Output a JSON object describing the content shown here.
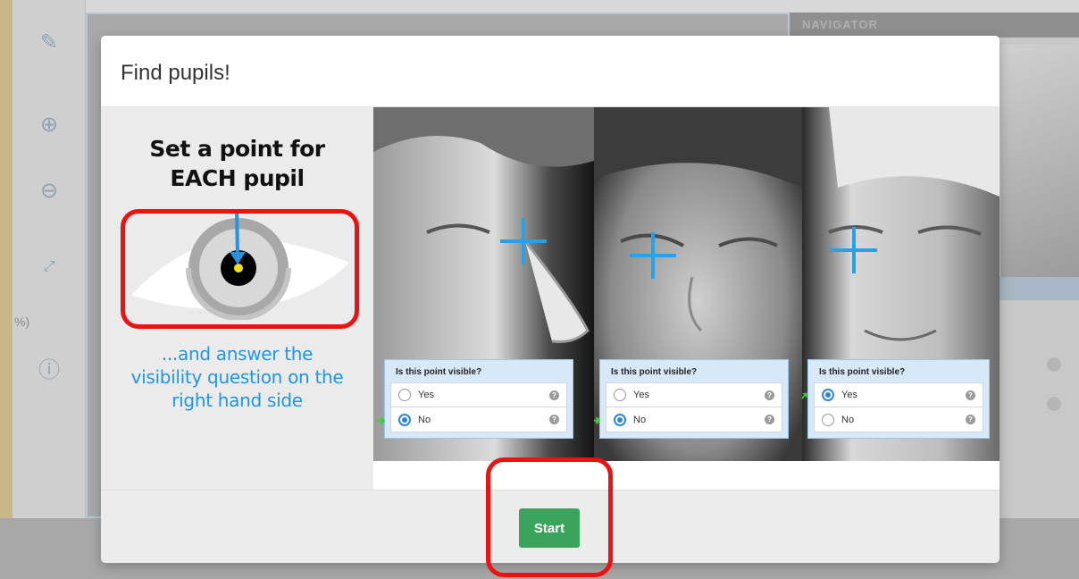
{
  "background": {
    "navigator_title": "NAVIGATOR",
    "percent_label": "%)"
  },
  "modal": {
    "title": "Find pupils!",
    "instructions": {
      "title_line1": "Set a point for",
      "title_line2": "EACH pupil",
      "subtitle_line1": "...and answer the",
      "subtitle_line2": "visibility question on the",
      "subtitle_line3": "right hand side"
    },
    "examples": [
      {
        "question": "Is this point visible?",
        "yes_label": "Yes",
        "no_label": "No",
        "selected": "No"
      },
      {
        "question": "Is this point visible?",
        "yes_label": "Yes",
        "no_label": "No",
        "selected": "No"
      },
      {
        "question": "Is this point visible?",
        "yes_label": "Yes",
        "no_label": "No",
        "selected": "Yes"
      }
    ],
    "start_label": "Start"
  },
  "colors": {
    "accent_blue": "#2196e0",
    "crosshair_blue": "#2aa0e8",
    "start_green": "#3aa35c",
    "callout_red": "#ee1111",
    "arrow_green": "#3fcf3a"
  },
  "icons": [
    "edit-icon",
    "zoom-in-icon",
    "zoom-out-icon",
    "fit-screen-icon",
    "info-icon",
    "help-icon",
    "eye-illustration"
  ]
}
